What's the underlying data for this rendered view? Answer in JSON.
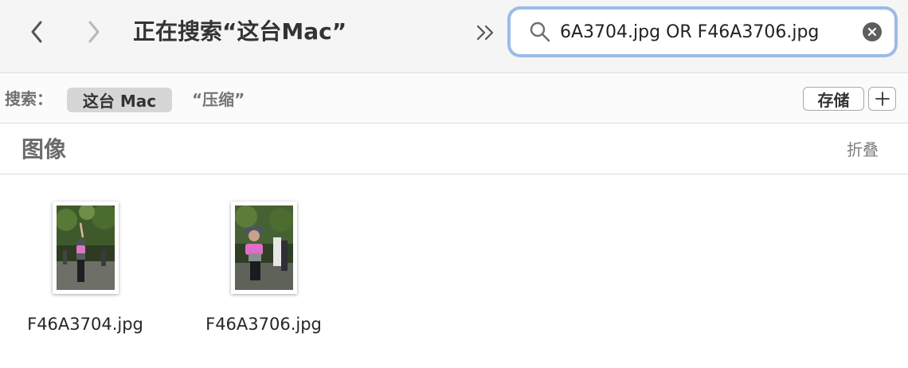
{
  "toolbar": {
    "title": "正在搜索“这台Mac”",
    "back_icon": "chevron-left-icon",
    "forward_icon": "chevron-right-icon",
    "overflow_icon": "double-chevron-right-icon"
  },
  "search": {
    "value": "6A3704.jpg OR F46A3706.jpg",
    "search_icon": "magnifier-icon",
    "clear_icon": "clear-circle-icon",
    "focus_ring_color": "#9bbbe8"
  },
  "scope": {
    "label": "搜索：",
    "this_mac": "这台 Mac",
    "folder": "“压缩”",
    "save_label": "存储",
    "add_icon": "plus-icon"
  },
  "section": {
    "title": "图像",
    "collapse_label": "折叠"
  },
  "files": [
    {
      "name": "F46A3704.jpg"
    },
    {
      "name": "F46A3706.jpg"
    }
  ]
}
